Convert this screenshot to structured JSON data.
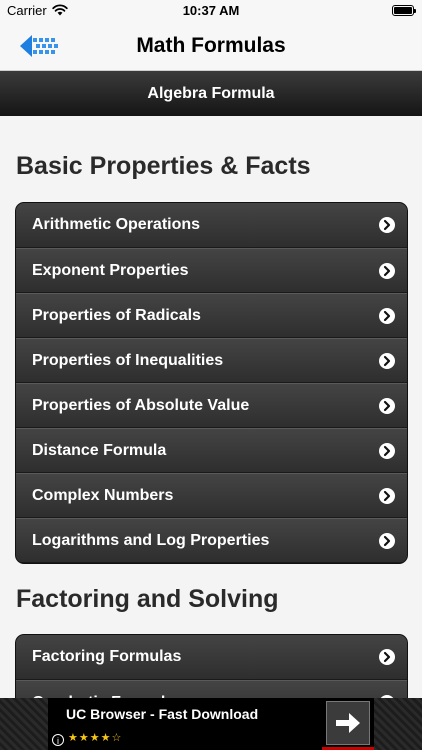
{
  "status_bar": {
    "carrier": "Carrier",
    "time": "10:37 AM"
  },
  "nav": {
    "title": "Math Formulas",
    "back_icon": "back-arrow-icon"
  },
  "sub_header": {
    "title": "Algebra Formula"
  },
  "sections": [
    {
      "title": "Basic Properties & Facts",
      "items": [
        "Arithmetic Operations",
        "Exponent Properties",
        "Properties of Radicals",
        "Properties of Inequalities",
        "Properties of Absolute Value",
        "Distance Formula",
        "Complex Numbers",
        "Logarithms and Log Properties"
      ]
    },
    {
      "title": "Factoring and Solving",
      "items": [
        "Factoring Formulas",
        "Quadratic Formula"
      ]
    }
  ],
  "ad": {
    "title": "UC Browser - Fast Download",
    "info": "i",
    "stars": "★★★★☆",
    "rating": 4.5
  },
  "colors": {
    "list_bg": "#3a3a3a",
    "header_bg": "#1f1f1f",
    "page_bg": "#f4f4f4"
  }
}
